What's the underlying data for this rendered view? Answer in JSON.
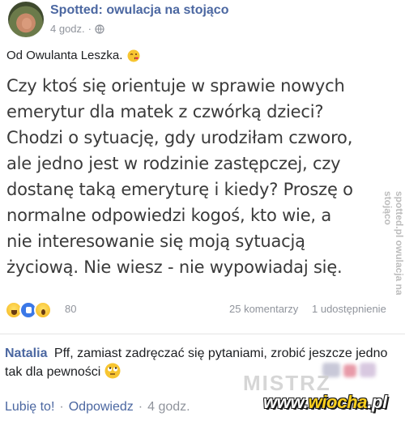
{
  "post": {
    "page_name": "Spotted: owulacja na stojąco",
    "time": "4 godz.",
    "time_separator": "·",
    "text": "Od Owulanta Leszka.",
    "image_lines": [
      "Czy ktoś się orientuje w sprawie nowych",
      "emerytur dla matek z czwórką dzieci?",
      "Chodzi o sytuację, gdy urodziłam czworo,",
      "ale jedno jest w rodzinie zastępczej, czy",
      "dostanę taką emeryturę i kiedy? Proszę o",
      "normalne odpowiedzi kogoś, kto wie, a",
      "nie interesowanie się moją sytuacją",
      "życiową. Nie wiesz - nie wypowiadaj się."
    ],
    "image_watermark": "spotted.pl owulacja na stojąco"
  },
  "reactions": {
    "count": "80",
    "comments": "25 komentarzy",
    "shares": "1 udostępnienie",
    "icons": [
      "haha-icon",
      "like-icon",
      "wow-icon"
    ]
  },
  "comment": {
    "author": "Natalia",
    "text": "Pff, zamiast zadręczać się pytaniami, zrobić jeszcze jedno tak dla pewności",
    "emoji": "rolling-eyes-icon",
    "like_label": "Lubię to!",
    "reply_label": "Odpowiedz",
    "separator": "·",
    "time": "4 godz."
  },
  "watermarks": {
    "mistrz": "MISTRZ",
    "wiocha_prefix": "www.",
    "wiocha_name": "wiocha",
    "wiocha_suffix": ".pl"
  },
  "colors": {
    "link_blue": "#4b67a1",
    "meta_gray": "#90949c",
    "text": "#1c1e21"
  }
}
